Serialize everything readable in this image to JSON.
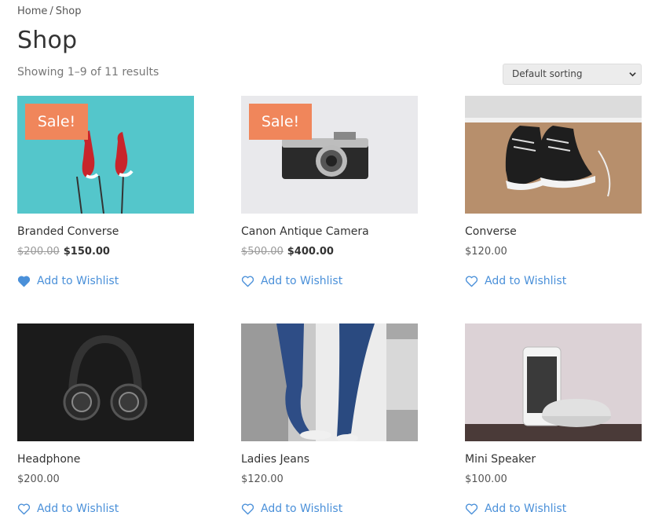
{
  "breadcrumb": {
    "home": "Home",
    "separator": "/",
    "current": "Shop"
  },
  "page_title": "Shop",
  "result_count": "Showing 1–9 of 11 results",
  "sorting": {
    "selected": "Default sorting"
  },
  "wishlist_label": "Add to Wishlist",
  "colors": {
    "accent": "#4a90d9",
    "sale_badge": "#f0865b"
  },
  "products": [
    {
      "name": "Branded Converse",
      "sale_badge": "Sale!",
      "old_price": "$200.00",
      "price": "$150.00",
      "wishlisted": true
    },
    {
      "name": "Canon Antique Camera",
      "sale_badge": "Sale!",
      "old_price": "$500.00",
      "price": "$400.00",
      "wishlisted": false
    },
    {
      "name": "Converse",
      "price": "$120.00",
      "wishlisted": false
    },
    {
      "name": "Headphone",
      "price": "$200.00",
      "wishlisted": false
    },
    {
      "name": "Ladies Jeans",
      "price": "$120.00",
      "wishlisted": false
    },
    {
      "name": "Mini Speaker",
      "price": "$100.00",
      "wishlisted": false
    }
  ]
}
